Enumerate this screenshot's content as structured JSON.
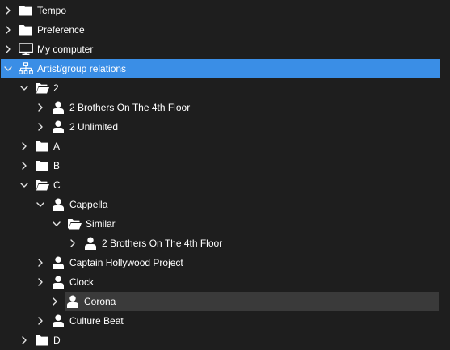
{
  "tree": {
    "items": [
      {
        "label": "Tempo",
        "icon": "folder-icon",
        "state": "collapsed",
        "level": 0
      },
      {
        "label": "Preference",
        "icon": "folder-icon",
        "state": "collapsed",
        "level": 0
      },
      {
        "label": "My computer",
        "icon": "monitor-icon",
        "state": "collapsed",
        "level": 0
      },
      {
        "label": "Artist/group relations",
        "icon": "hierarchy-icon",
        "state": "expanded",
        "level": 0,
        "selected": true
      },
      {
        "label": "2",
        "icon": "folder-open-icon",
        "state": "expanded",
        "level": 1
      },
      {
        "label": "2 Brothers On The 4th Floor",
        "icon": "person-icon",
        "state": "collapsed",
        "level": 2
      },
      {
        "label": "2 Unlimited",
        "icon": "person-icon",
        "state": "collapsed",
        "level": 2
      },
      {
        "label": "A",
        "icon": "folder-icon",
        "state": "collapsed",
        "level": 1
      },
      {
        "label": "B",
        "icon": "folder-icon",
        "state": "collapsed",
        "level": 1
      },
      {
        "label": "C",
        "icon": "folder-open-icon",
        "state": "expanded",
        "level": 1
      },
      {
        "label": "Cappella",
        "icon": "person-icon",
        "state": "expanded",
        "level": 2
      },
      {
        "label": "Similar",
        "icon": "folder-open-icon",
        "state": "expanded",
        "level": 3
      },
      {
        "label": "2 Brothers On The 4th Floor",
        "icon": "person-icon",
        "state": "collapsed",
        "level": 4
      },
      {
        "label": "Captain Hollywood Project",
        "icon": "person-icon",
        "state": "collapsed",
        "level": 2
      },
      {
        "label": "Clock",
        "icon": "person-icon",
        "state": "collapsed",
        "level": 2
      },
      {
        "label": "Corona",
        "icon": "person-icon",
        "state": "collapsed",
        "level": 2,
        "hover": true
      },
      {
        "label": "Culture Beat",
        "icon": "person-icon",
        "state": "collapsed",
        "level": 2
      },
      {
        "label": "D",
        "icon": "folder-icon",
        "state": "collapsed",
        "level": 1
      }
    ]
  },
  "colors": {
    "background": "#1e1e1e",
    "selected": "#3a8ee6",
    "hover": "#3a3a3a",
    "text": "#ffffff",
    "chevron": "#e6e6e6"
  }
}
